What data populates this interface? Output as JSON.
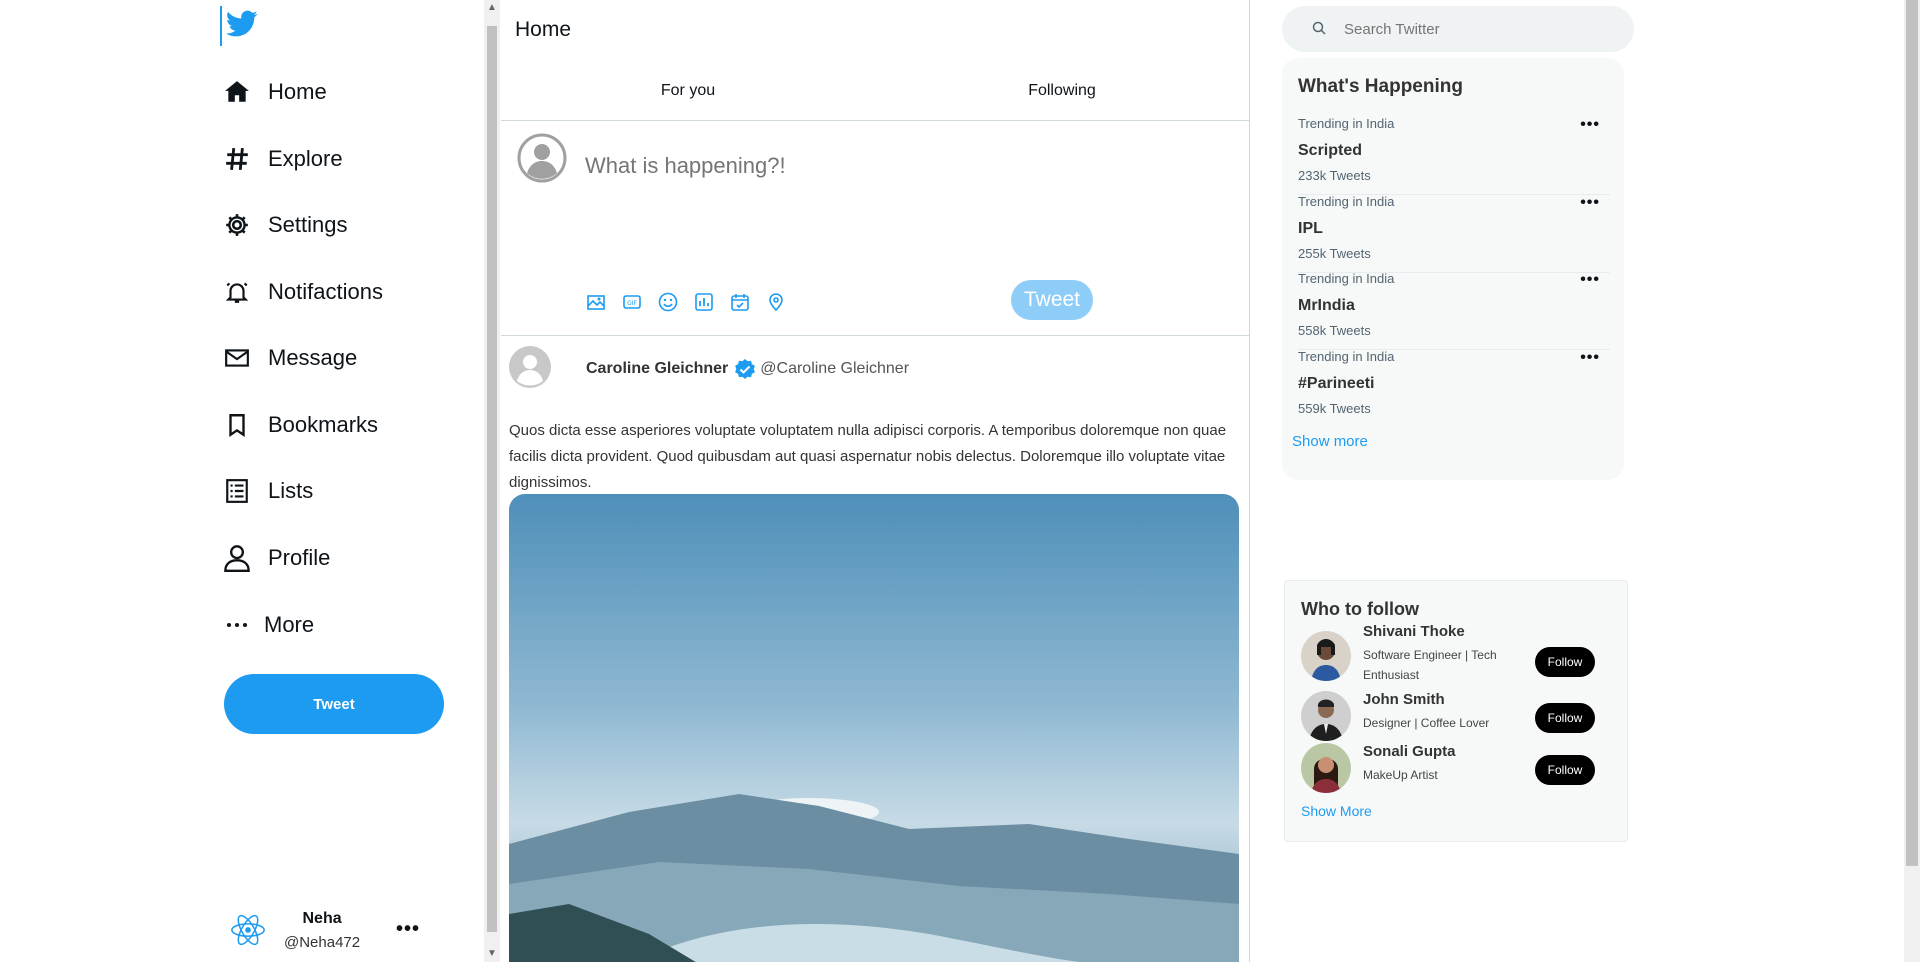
{
  "nav": {
    "items": [
      {
        "label": "Home",
        "icon": "home-icon"
      },
      {
        "label": "Explore",
        "icon": "hashtag-icon"
      },
      {
        "label": "Settings",
        "icon": "gear-icon"
      },
      {
        "label": "Notifactions",
        "icon": "bell-icon"
      },
      {
        "label": "Message",
        "icon": "mail-icon"
      },
      {
        "label": "Bookmarks",
        "icon": "bookmark-icon"
      },
      {
        "label": "Lists",
        "icon": "list-icon"
      },
      {
        "label": "Profile",
        "icon": "person-icon"
      },
      {
        "label": "More",
        "icon": "more-icon"
      }
    ],
    "tweet_label": "Tweet"
  },
  "user": {
    "name": "Neha",
    "handle": "@Neha472",
    "more": "•••"
  },
  "main": {
    "title": "Home",
    "tabs": [
      "For you",
      "Following"
    ],
    "composer": {
      "placeholder": "What is happening?!",
      "button": "Tweet"
    },
    "post": {
      "author": "Caroline Gleichner",
      "handle": "@Caroline Gleichner",
      "text": "Quos dicta esse asperiores voluptate voluptatem nulla adipisci corporis. A temporibus doloremque non quae facilis dicta provident. Quod quibusdam aut quasi aspernatur nobis delectus. Doloremque illo voluptate vitae dignissimos."
    }
  },
  "search": {
    "placeholder": "Search Twitter"
  },
  "trends": {
    "title": "What's Happening",
    "items": [
      {
        "meta": "Trending in India",
        "name": "Scripted",
        "count": "233k Tweets"
      },
      {
        "meta": "Trending in India",
        "name": "IPL",
        "count": "255k Tweets"
      },
      {
        "meta": "Trending in India",
        "name": "MrIndia",
        "count": "558k Tweets"
      },
      {
        "meta": "Trending in India",
        "name": "#Parineeti",
        "count": "559k Tweets"
      }
    ],
    "dots": "•••",
    "show_more": "Show more"
  },
  "who_to_follow": {
    "title": "Who to follow",
    "people": [
      {
        "name": "Shivani Thoke",
        "bio": "Software Engineer | Tech Enthusiast",
        "button": "Follow"
      },
      {
        "name": "John Smith",
        "bio": "Designer | Coffee Lover",
        "button": "Follow"
      },
      {
        "name": "Sonali Gupta",
        "bio": "MakeUp Artist",
        "button": "Follow"
      }
    ],
    "show_more": "Show More"
  },
  "colors": {
    "accent": "#1d9bf0",
    "accent_light": "#8ecdf8",
    "panel": "#f7f9f9"
  }
}
